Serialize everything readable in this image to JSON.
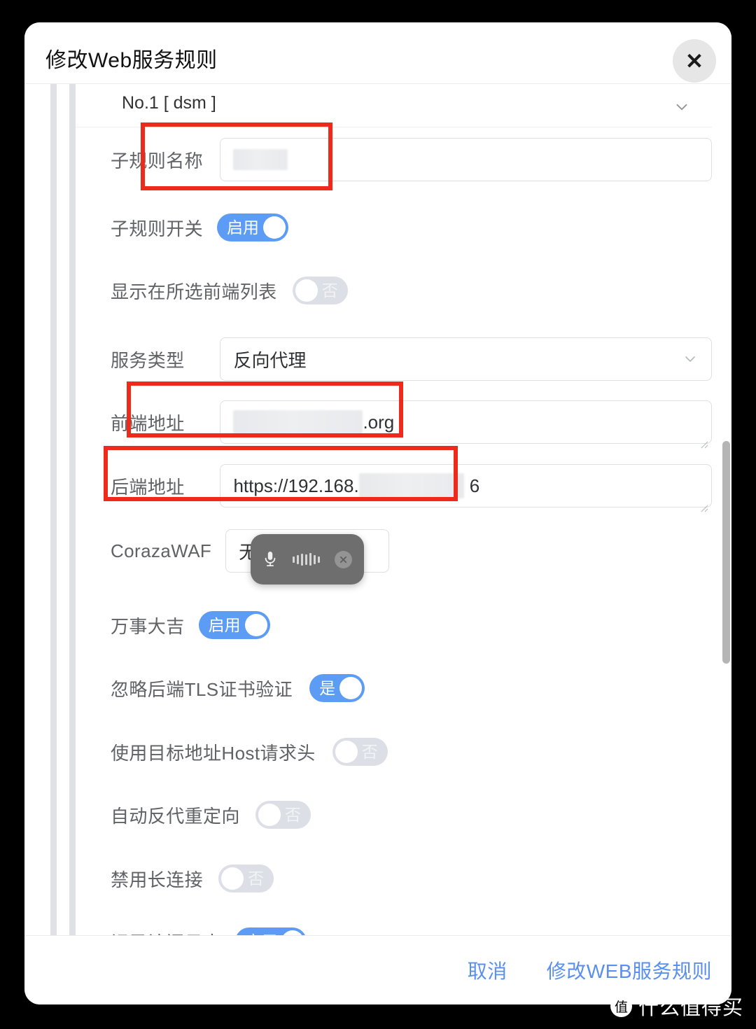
{
  "dialog": {
    "title": "修改Web服务规则",
    "close_icon": "close-icon",
    "close_glyph": "✕"
  },
  "group": {
    "title": "No.1 [ dsm ]",
    "collapse_icon": "chevron-down-icon"
  },
  "form": {
    "sub_rule_name": {
      "label": "子规则名称",
      "value": "",
      "redacted": true
    },
    "sub_rule_switch": {
      "label": "子规则开关",
      "state": "启用",
      "on": true
    },
    "show_in_frontend_list": {
      "label": "显示在所选前端列表",
      "state": "否",
      "on": false
    },
    "service_type": {
      "label": "服务类型",
      "value": "反向代理",
      "dropdown_icon": "chevron-down-icon"
    },
    "frontend_address": {
      "label": "前端地址",
      "value_suffix": ".org",
      "redacted": true
    },
    "backend_address": {
      "label": "后端地址",
      "value_prefix": "https://192.168.",
      "value_suffix": "6",
      "redacted": true
    },
    "coraza_waf": {
      "label": "CorazaWAF",
      "value": "无"
    },
    "all_good": {
      "label": "万事大吉",
      "state": "启用",
      "on": true
    },
    "ignore_backend_tls": {
      "label": "忽略后端TLS证书验证",
      "state": "是",
      "on": true
    },
    "use_target_host_header": {
      "label": "使用目标地址Host请求头",
      "state": "否",
      "on": false
    },
    "auto_proxy_redirect": {
      "label": "自动反代重定向",
      "state": "否",
      "on": false
    },
    "disable_keepalive": {
      "label": "禁用长连接",
      "state": "否",
      "on": false
    },
    "access_log": {
      "label": "记录访问日志",
      "state": "启用",
      "on": true
    }
  },
  "voice_overlay": {
    "mic_icon": "microphone-icon",
    "close_icon": "close-circle-icon",
    "waveform_bars": [
      9,
      13,
      17,
      15,
      18,
      13,
      9
    ]
  },
  "footer": {
    "cancel": "取消",
    "confirm": "修改WEB服务规则"
  },
  "watermark": {
    "logo_char": "值",
    "text": "什么值得买"
  },
  "colors": {
    "accent_blue": "#5d9cf5",
    "link_blue": "#5a8ff0",
    "annotation_red": "#ee2b1b",
    "toggle_off_gray": "#dcdfe6",
    "border_gray": "#dcdfe6"
  }
}
